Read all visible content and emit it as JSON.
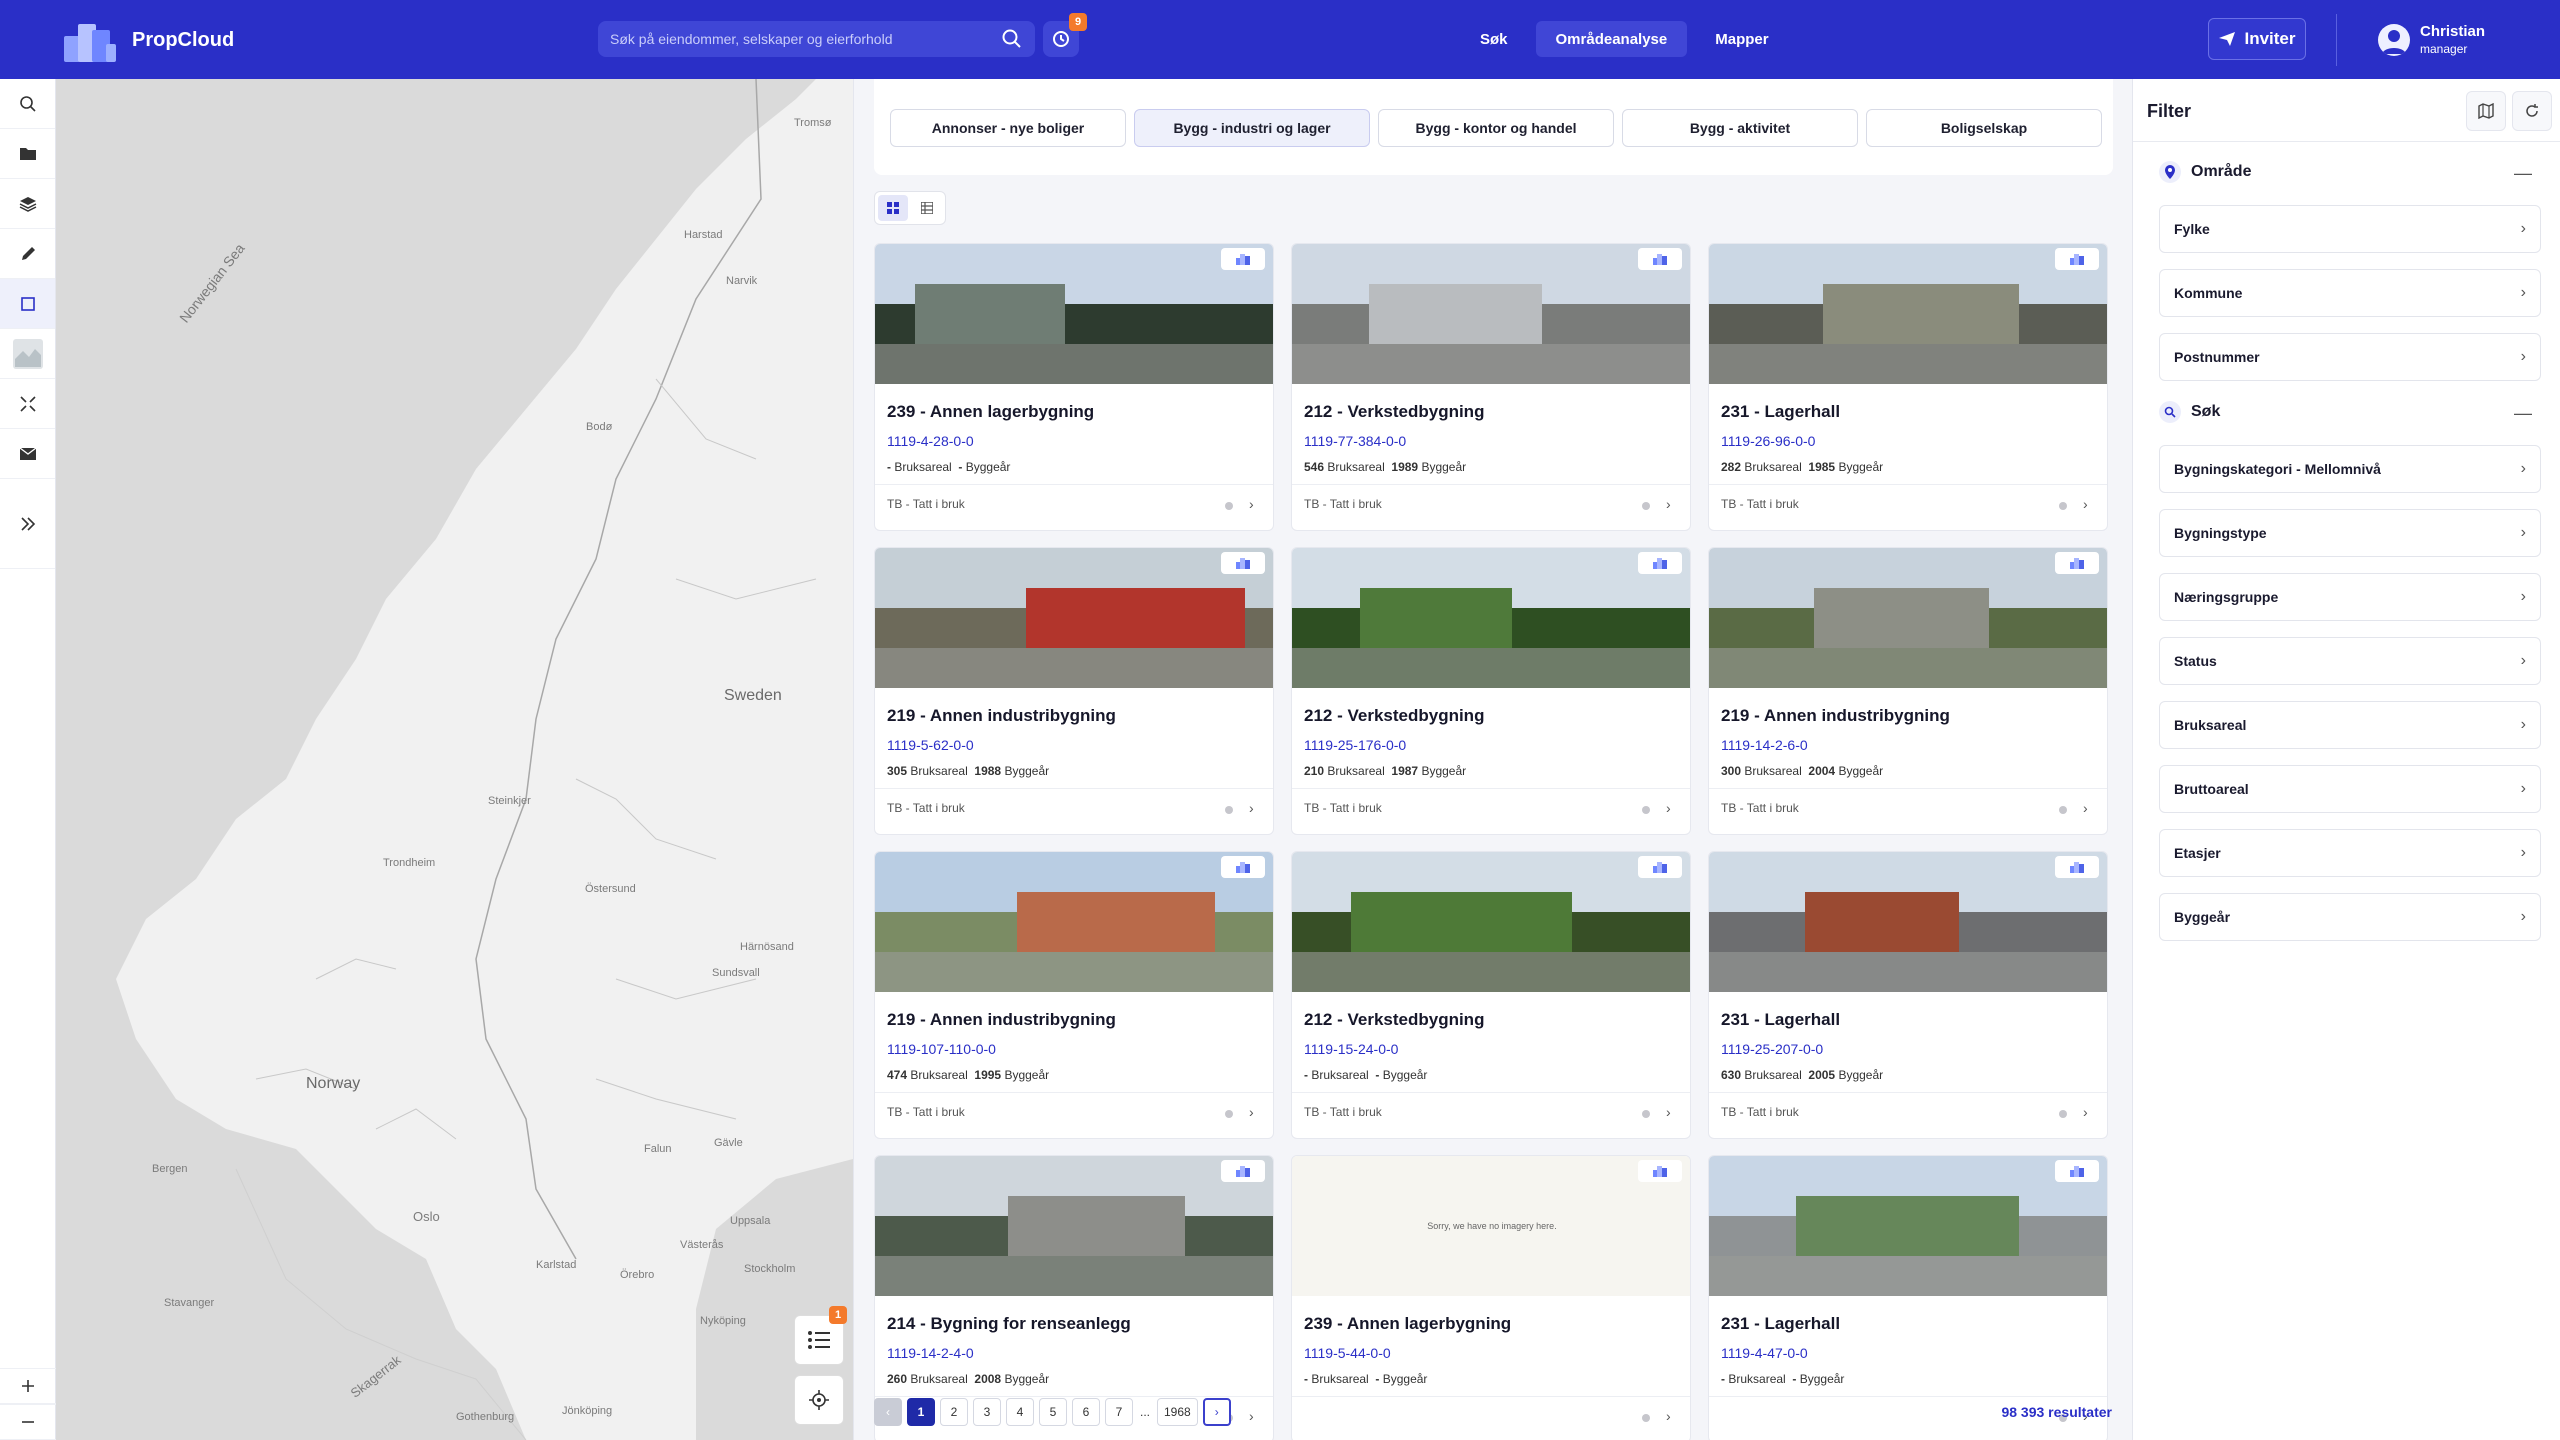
{
  "app": {
    "name": "PropCloud"
  },
  "search": {
    "placeholder": "Søk på eiendommer, selskaper og eierforhold",
    "history_badge": "9"
  },
  "nav": {
    "items": [
      "Søk",
      "Områdeanalyse",
      "Mapper"
    ],
    "active": "Områdeanalyse"
  },
  "invite": {
    "label": "Inviter"
  },
  "user": {
    "name": "Christian",
    "role": "manager"
  },
  "map": {
    "labels": [
      "Norwegian Sea",
      "Sweden",
      "Norway",
      "Trondheim",
      "Östersund",
      "Bergen",
      "Oslo",
      "Stavanger",
      "Falun",
      "Gävle",
      "Uppsala",
      "Stockholm",
      "Västerås",
      "Örebro",
      "Karlstad",
      "Nyköping",
      "Jönköping",
      "Gothenburg",
      "Skagerrak",
      "Härnösand",
      "Sundsvall",
      "Steinkjer",
      "Bodø",
      "Narvik",
      "Tromsø",
      "Harstad"
    ],
    "list_badge": "1"
  },
  "categories": [
    "Annonser - nye boliger",
    "Bygg - industri og lager",
    "Bygg - kontor og handel",
    "Bygg - aktivitet",
    "Boligselskap"
  ],
  "active_category": "Bygg - industri og lager",
  "cards": [
    {
      "title": "239 - Annen lagerbygning",
      "id": "1119-4-28-0-0",
      "area": "-",
      "area_label": "Bruksareal",
      "year": "-",
      "year_label": "Byggeår",
      "status": "TB - Tatt i bruk"
    },
    {
      "title": "212 - Verkstedbygning",
      "id": "1119-77-384-0-0",
      "area": "546",
      "area_label": "Bruksareal",
      "year": "1989",
      "year_label": "Byggeår",
      "status": "TB - Tatt i bruk"
    },
    {
      "title": "231 - Lagerhall",
      "id": "1119-26-96-0-0",
      "area": "282",
      "area_label": "Bruksareal",
      "year": "1985",
      "year_label": "Byggeår",
      "status": "TB - Tatt i bruk"
    },
    {
      "title": "219 - Annen industribygning",
      "id": "1119-5-62-0-0",
      "area": "305",
      "area_label": "Bruksareal",
      "year": "1988",
      "year_label": "Byggeår",
      "status": "TB - Tatt i bruk"
    },
    {
      "title": "212 - Verkstedbygning",
      "id": "1119-25-176-0-0",
      "area": "210",
      "area_label": "Bruksareal",
      "year": "1987",
      "year_label": "Byggeår",
      "status": "TB - Tatt i bruk"
    },
    {
      "title": "219 - Annen industribygning",
      "id": "1119-14-2-6-0",
      "area": "300",
      "area_label": "Bruksareal",
      "year": "2004",
      "year_label": "Byggeår",
      "status": "TB - Tatt i bruk"
    },
    {
      "title": "219 - Annen industribygning",
      "id": "1119-107-110-0-0",
      "area": "474",
      "area_label": "Bruksareal",
      "year": "1995",
      "year_label": "Byggeår",
      "status": "TB - Tatt i bruk"
    },
    {
      "title": "212 - Verkstedbygning",
      "id": "1119-15-24-0-0",
      "area": "-",
      "area_label": "Bruksareal",
      "year": "-",
      "year_label": "Byggeår",
      "status": "TB - Tatt i bruk"
    },
    {
      "title": "231 - Lagerhall",
      "id": "1119-25-207-0-0",
      "area": "630",
      "area_label": "Bruksareal",
      "year": "2005",
      "year_label": "Byggeår",
      "status": "TB - Tatt i bruk"
    },
    {
      "title": "214 - Bygning for renseanlegg",
      "id": "1119-14-2-4-0",
      "area": "260",
      "area_label": "Bruksareal",
      "year": "2008",
      "year_label": "Byggeår",
      "status": ""
    },
    {
      "title": "239 - Annen lagerbygning",
      "id": "1119-5-44-0-0",
      "area": "-",
      "area_label": "Bruksareal",
      "year": "-",
      "year_label": "Byggeår",
      "status": "",
      "no_image_text": "Sorry, we have no imagery here."
    },
    {
      "title": "231 - Lagerhall",
      "id": "1119-4-47-0-0",
      "area": "-",
      "area_label": "Bruksareal",
      "year": "-",
      "year_label": "Byggeår",
      "status": ""
    }
  ],
  "pagination": {
    "pages": [
      "1",
      "2",
      "3",
      "4",
      "5",
      "6",
      "7"
    ],
    "ellipsis": "...",
    "last": "1968",
    "current": "1"
  },
  "results": "98 393 resultater",
  "filter": {
    "title": "Filter",
    "sections": [
      {
        "title": "Område",
        "collapse": "—",
        "items": [
          "Fylke",
          "Kommune",
          "Postnummer"
        ]
      },
      {
        "title": "Søk",
        "collapse": "—",
        "items": [
          "Bygningskategori - Mellomnivå",
          "Bygningstype",
          "Næringsgruppe",
          "Status",
          "Bruksareal",
          "Bruttoareal",
          "Etasjer",
          "Byggeår"
        ]
      }
    ]
  },
  "colors": {
    "primary": "#2a2fc7",
    "accent_badge": "#f47a2b"
  }
}
